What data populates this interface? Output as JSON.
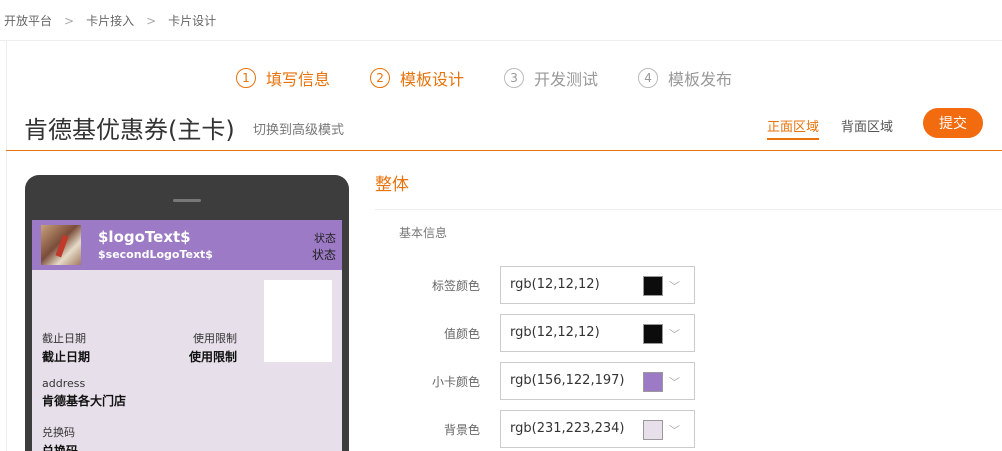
{
  "breadcrumb": [
    "开放平台",
    "卡片接入",
    "卡片设计"
  ],
  "steps": [
    {
      "num": "1",
      "label": "填写信息"
    },
    {
      "num": "2",
      "label": "模板设计"
    },
    {
      "num": "3",
      "label": "开发测试"
    },
    {
      "num": "4",
      "label": "模板发布"
    }
  ],
  "header": {
    "title": "肯德基优惠券(主卡)",
    "switch_link": "切换到高级模式",
    "tab_front": "正面区域",
    "tab_back": "背面区域",
    "submit": "提交"
  },
  "card": {
    "logo_text": "$logoText$",
    "second_logo_text": "$secondLogoText$",
    "status_label": "状态",
    "status_value": "状态",
    "expiry_label": "截止日期",
    "expiry_value": "截止日期",
    "limit_label": "使用限制",
    "limit_value": "使用限制",
    "address_label": "address",
    "address_value": "肯德基各大门店",
    "code_label": "兑换码",
    "code_value": "兑换码"
  },
  "panel": {
    "section_title": "整体",
    "basic_info": "基本信息",
    "colors": [
      {
        "label": "标签颜色",
        "value": "rgb(12,12,12)",
        "hex": "#0c0c0c"
      },
      {
        "label": "值颜色",
        "value": "rgb(12,12,12)",
        "hex": "#0c0c0c"
      },
      {
        "label": "小卡颜色",
        "value": "rgb(156,122,197)",
        "hex": "#9c7ac5"
      },
      {
        "label": "背景色",
        "value": "rgb(231,223,234)",
        "hex": "#e7dfea"
      }
    ]
  }
}
